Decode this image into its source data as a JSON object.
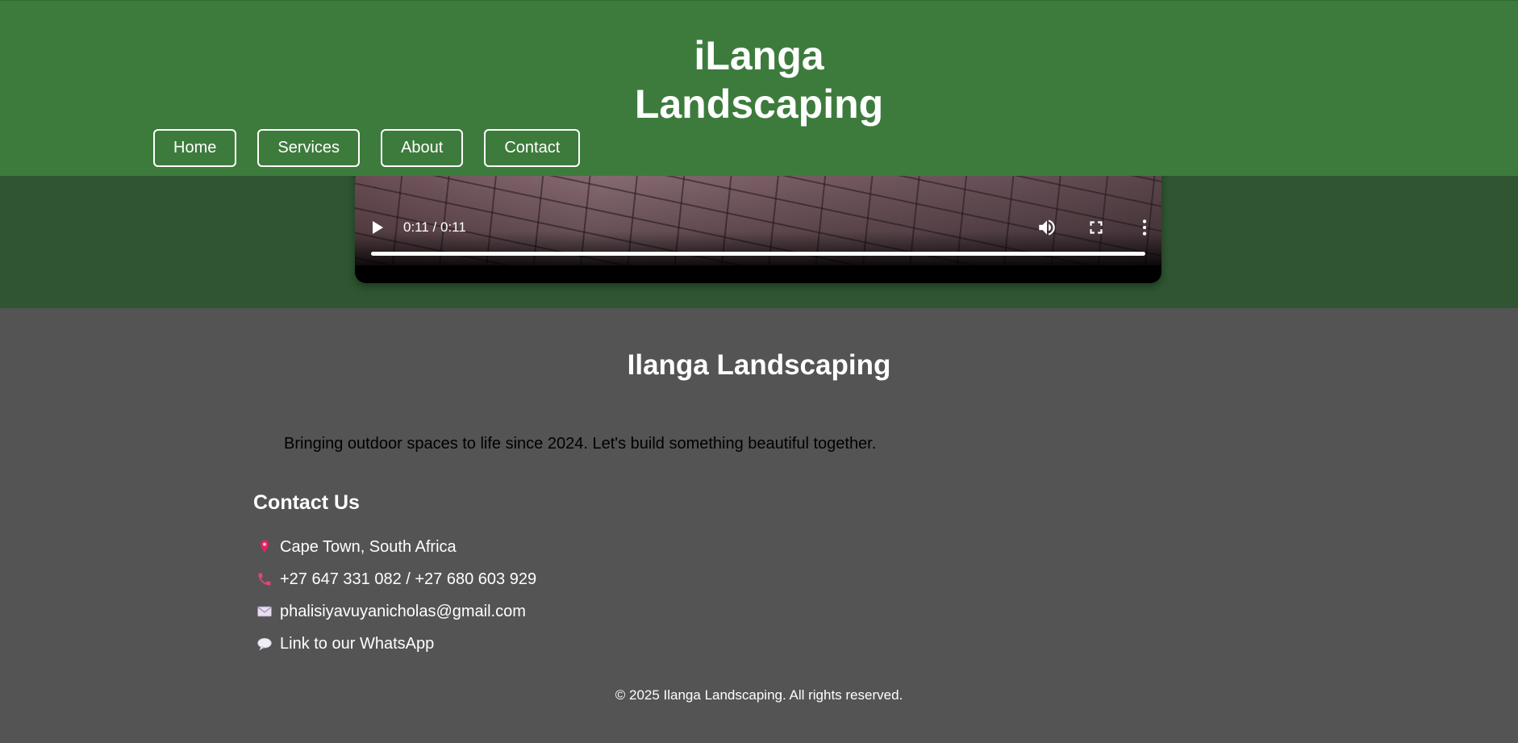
{
  "header": {
    "title_line1": "iLanga",
    "title_line2": "Landscaping",
    "bg_color": "#3d7b3d"
  },
  "nav": {
    "items": [
      {
        "label": "Home"
      },
      {
        "label": "Services"
      },
      {
        "label": "About"
      },
      {
        "label": "Contact"
      }
    ]
  },
  "video": {
    "time": "0:11 / 0:11",
    "progress_fraction": 1.0,
    "icons": [
      "play-icon",
      "volume-icon",
      "fullscreen-icon",
      "more-options-icon"
    ]
  },
  "footer": {
    "title": "Ilanga Landscaping",
    "tagline": "Bringing outdoor spaces to life since 2024. Let's build something beautiful together.",
    "contact_heading": "Contact Us",
    "contacts": [
      {
        "icon": "map-pin-icon",
        "text": "Cape Town, South Africa"
      },
      {
        "icon": "phone-icon",
        "text": "+27 647 331 082 / +27 680 603 929"
      },
      {
        "icon": "envelope-icon",
        "text": "phalisiyavuyanicholas@gmail.com"
      },
      {
        "icon": "speech-bubble-icon",
        "text": "Link to our WhatsApp"
      }
    ],
    "copyright": "© 2025 Ilanga Landscaping. All rights reserved.",
    "bg_color": "#545454"
  }
}
